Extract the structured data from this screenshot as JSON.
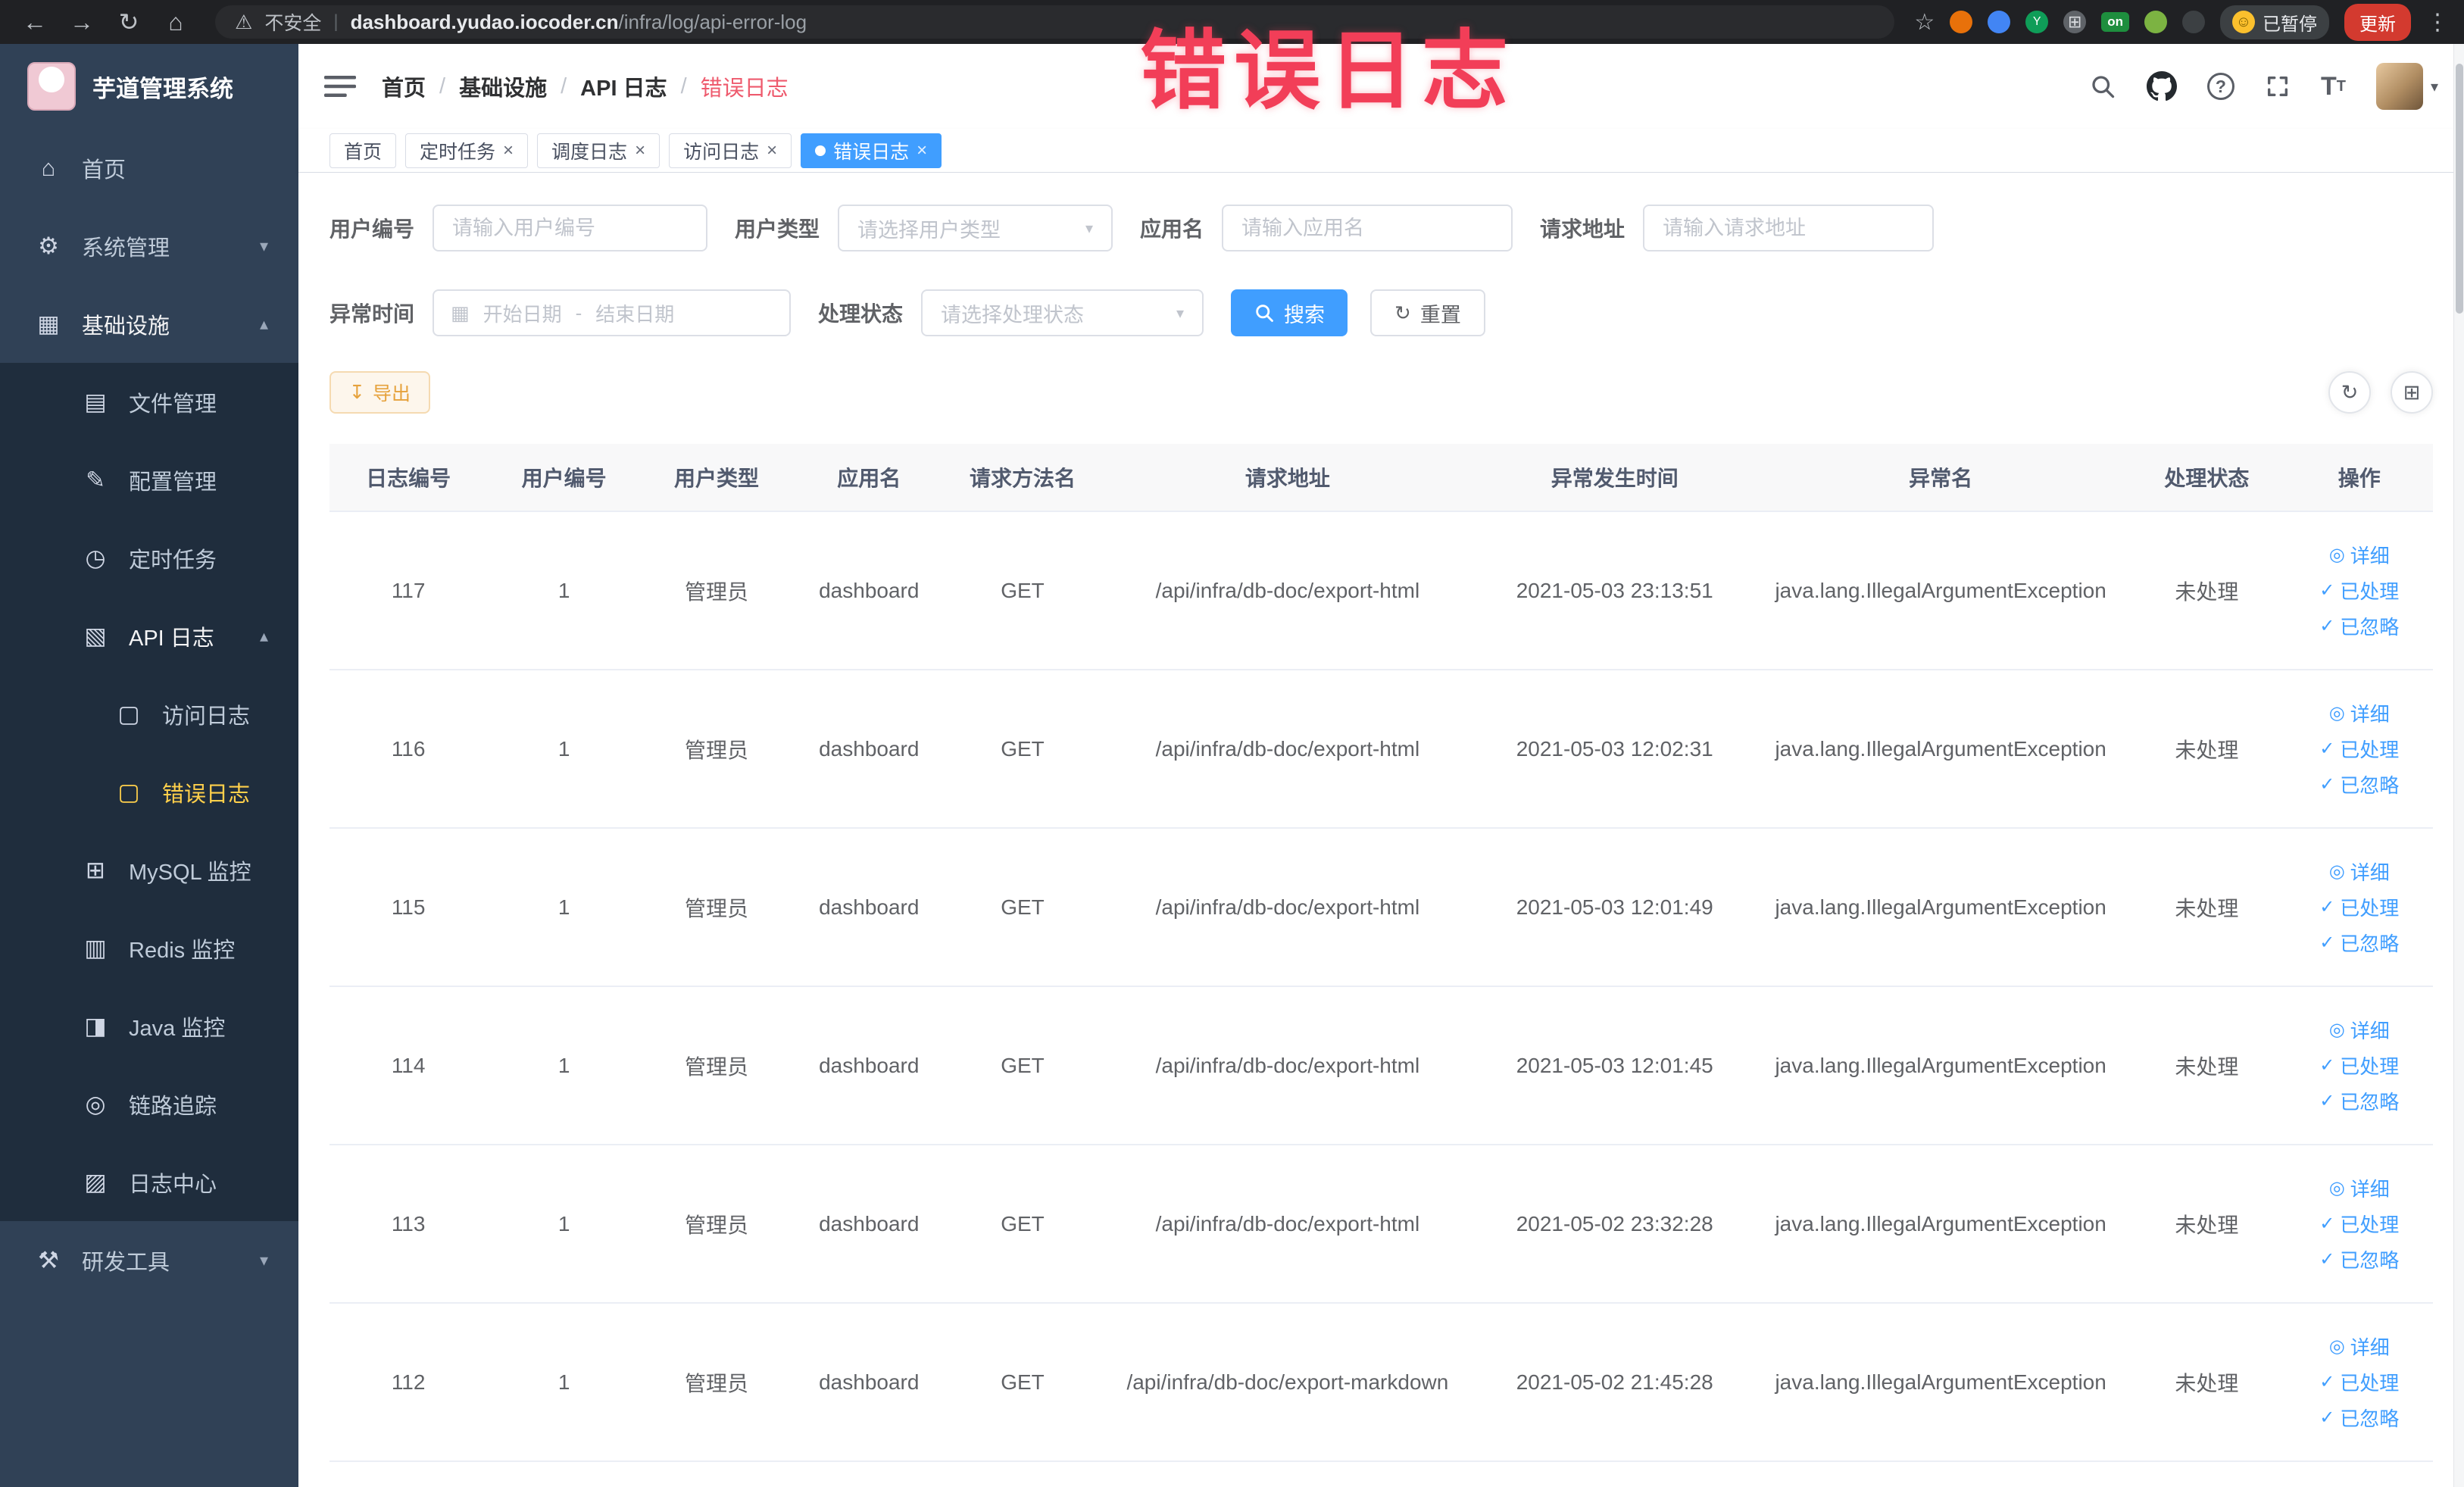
{
  "browser": {
    "security": "不安全",
    "url_domain": "dashboard.yudao.iocoder.cn",
    "url_path": "/infra/log/api-error-log",
    "on_badge": "on",
    "paused": "已暂停",
    "update": "更新"
  },
  "annotation": {
    "text": "错误日志",
    "color": "#f23e58"
  },
  "sidebar": {
    "title": "芋道管理系统",
    "menu": [
      {
        "key": "home",
        "label": "首页",
        "icon": "home-icon",
        "level": 1
      },
      {
        "key": "system-management",
        "label": "系统管理",
        "icon": "gear-icon",
        "level": 1,
        "chevron": "down"
      },
      {
        "key": "infrastructure",
        "label": "基础设施",
        "icon": "infra-icon",
        "level": 1,
        "chevron": "up",
        "open": true
      },
      {
        "key": "file-management",
        "label": "文件管理",
        "icon": "file-icon",
        "level": 2
      },
      {
        "key": "config-management",
        "label": "配置管理",
        "icon": "config-icon",
        "level": 2
      },
      {
        "key": "scheduled-tasks",
        "label": "定时任务",
        "icon": "timer-icon",
        "level": 2
      },
      {
        "key": "api-log",
        "label": "API 日志",
        "icon": "apilog-icon",
        "level": 2,
        "chevron": "up",
        "open": true
      },
      {
        "key": "access-log",
        "label": "访问日志",
        "icon": "doc-icon",
        "level": 3
      },
      {
        "key": "error-log",
        "label": "错误日志",
        "icon": "doc-icon",
        "level": 3,
        "active": true
      },
      {
        "key": "mysql-monitor",
        "label": "MySQL 监控",
        "icon": "mysql-icon",
        "level": 2
      },
      {
        "key": "redis-monitor",
        "label": "Redis 监控",
        "icon": "redis-icon",
        "level": 2
      },
      {
        "key": "java-monitor",
        "label": "Java 监控",
        "icon": "java-icon",
        "level": 2
      },
      {
        "key": "trace",
        "label": "链路追踪",
        "icon": "trace-icon",
        "level": 2
      },
      {
        "key": "log-center",
        "label": "日志中心",
        "icon": "logcenter-icon",
        "level": 2
      },
      {
        "key": "dev-tools",
        "label": "研发工具",
        "icon": "tools-icon",
        "level": 1,
        "chevron": "down"
      }
    ]
  },
  "header": {
    "breadcrumbs": [
      "首页",
      "基础设施",
      "API 日志",
      "错误日志"
    ]
  },
  "tabs": [
    {
      "key": "home",
      "label": "首页"
    },
    {
      "key": "scheduled-tasks",
      "label": "定时任务",
      "closable": true
    },
    {
      "key": "schedule-log",
      "label": "调度日志",
      "closable": true
    },
    {
      "key": "access-log",
      "label": "访问日志",
      "closable": true
    },
    {
      "key": "error-log",
      "label": "错误日志",
      "closable": true,
      "active": true
    }
  ],
  "filters": {
    "user_id": {
      "label": "用户编号",
      "placeholder": "请输入用户编号"
    },
    "user_type": {
      "label": "用户类型",
      "placeholder": "请选择用户类型"
    },
    "app_name": {
      "label": "应用名",
      "placeholder": "请输入应用名"
    },
    "request_url": {
      "label": "请求地址",
      "placeholder": "请输入请求地址"
    },
    "exception_time": {
      "label": "异常时间",
      "start_placeholder": "开始日期",
      "separator": "-",
      "end_placeholder": "结束日期"
    },
    "process_status": {
      "label": "处理状态",
      "placeholder": "请选择处理状态"
    },
    "search": "搜索",
    "reset": "重置"
  },
  "toolbar": {
    "export": "导出"
  },
  "table": {
    "columns": [
      "日志编号",
      "用户编号",
      "用户类型",
      "应用名",
      "请求方法名",
      "请求地址",
      "异常发生时间",
      "异常名",
      "处理状态",
      "操作"
    ],
    "actions": {
      "detail": "详细",
      "processed": "已处理",
      "ignored": "已忽略"
    },
    "rows": [
      {
        "id": "117",
        "user_id": "1",
        "user_type": "管理员",
        "app": "dashboard",
        "method": "GET",
        "url": "/api/infra/db-doc/export-html",
        "time": "2021-05-03 23:13:51",
        "exception": "java.lang.IllegalArgumentException",
        "status": "未处理"
      },
      {
        "id": "116",
        "user_id": "1",
        "user_type": "管理员",
        "app": "dashboard",
        "method": "GET",
        "url": "/api/infra/db-doc/export-html",
        "time": "2021-05-03 12:02:31",
        "exception": "java.lang.IllegalArgumentException",
        "status": "未处理"
      },
      {
        "id": "115",
        "user_id": "1",
        "user_type": "管理员",
        "app": "dashboard",
        "method": "GET",
        "url": "/api/infra/db-doc/export-html",
        "time": "2021-05-03 12:01:49",
        "exception": "java.lang.IllegalArgumentException",
        "status": "未处理"
      },
      {
        "id": "114",
        "user_id": "1",
        "user_type": "管理员",
        "app": "dashboard",
        "method": "GET",
        "url": "/api/infra/db-doc/export-html",
        "time": "2021-05-03 12:01:45",
        "exception": "java.lang.IllegalArgumentException",
        "status": "未处理"
      },
      {
        "id": "113",
        "user_id": "1",
        "user_type": "管理员",
        "app": "dashboard",
        "method": "GET",
        "url": "/api/infra/db-doc/export-html",
        "time": "2021-05-02 23:32:28",
        "exception": "java.lang.IllegalArgumentException",
        "status": "未处理"
      },
      {
        "id": "112",
        "user_id": "1",
        "user_type": "管理员",
        "app": "dashboard",
        "method": "GET",
        "url": "/api/infra/db-doc/export-markdown",
        "time": "2021-05-02 21:45:28",
        "exception": "java.lang.IllegalArgumentException",
        "status": "未处理"
      }
    ]
  },
  "colors": {
    "accent": "#409EFF",
    "warning": "#e6a23c",
    "sidebar_bg": "#304156",
    "submenu_bg": "#1f2d3d",
    "active_text": "#ffd04b",
    "annotation": "#f23e58",
    "link": "#409EFF",
    "browser_bg": "#202124"
  }
}
